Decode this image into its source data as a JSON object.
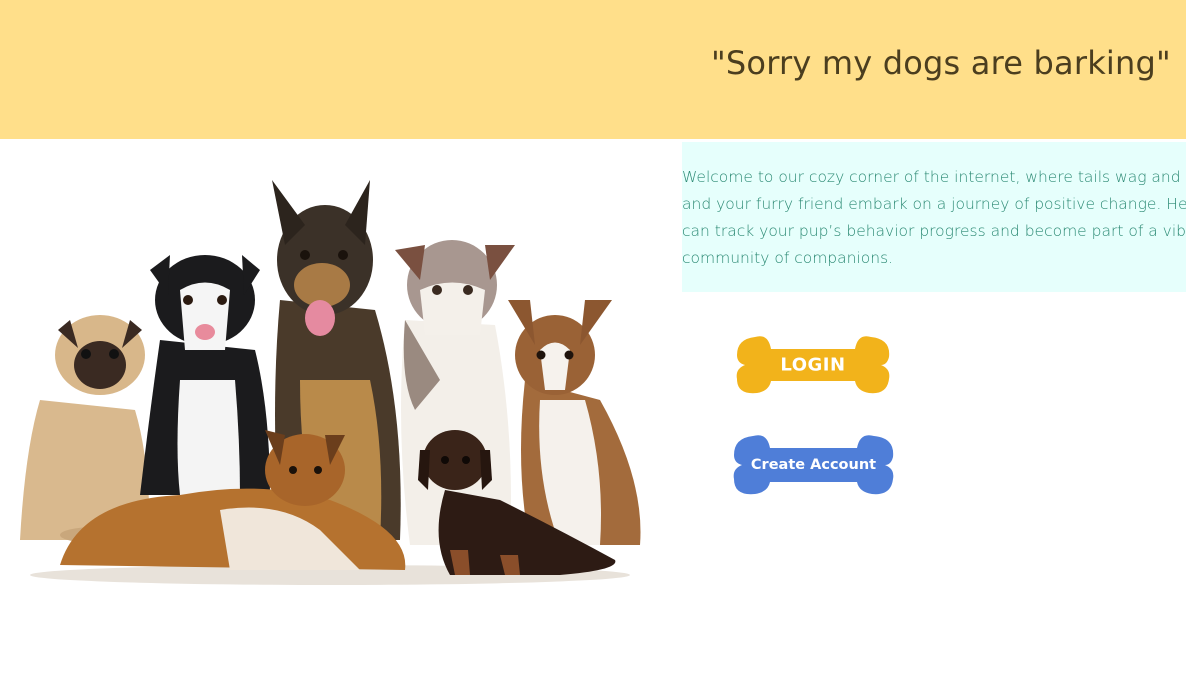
{
  "header": {
    "title": "\"Sorry my dogs are barking\"",
    "background_color": "#ffdf8a"
  },
  "hero": {
    "image": "group-of-dogs-photo"
  },
  "welcome": {
    "text": "Welcome to our cozy corner of the internet, where tails wag and you and your furry friend embark on a journey of positive change. Here you can track your pup’s behavior progress and become part of a vibrant community of companions.",
    "background_color": "#e6fffc"
  },
  "buttons": {
    "login_label": "LOGIN",
    "login_color": "#f2b31b",
    "create_account_label": "Create Account",
    "create_account_color": "#4f7ed8"
  }
}
